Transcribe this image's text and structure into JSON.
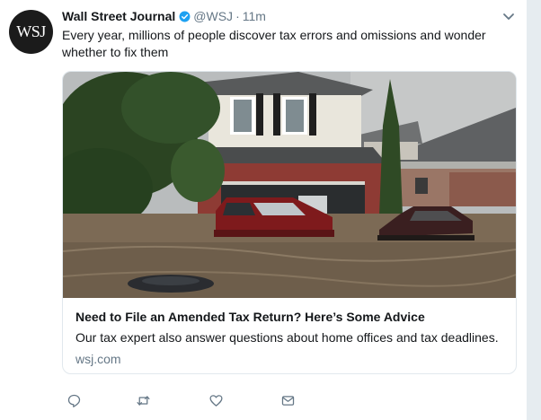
{
  "tweet": {
    "author_name": "Wall Street Journal",
    "author_handle": "@WSJ",
    "separator": "·",
    "time": "11m",
    "avatar_text": "WSJ",
    "text": "Every year, millions of people discover tax errors and omissions and wonder whether to fix them"
  },
  "card": {
    "title": "Need to File an Amended Tax Return? Here’s Some Advice",
    "description": "Our tax expert also answer questions about home offices and tax deadlines.",
    "domain": "wsj.com"
  },
  "icons": {
    "verified": "verified-badge-icon",
    "caret": "chevron-down-icon",
    "reply": "reply-icon",
    "retweet": "retweet-icon",
    "like": "heart-icon",
    "message": "envelope-icon"
  },
  "colors": {
    "text": "#14171a",
    "secondary": "#657786",
    "verified": "#1da1f2",
    "border": "#e1e8ed",
    "gutter": "#e6ecf0"
  }
}
